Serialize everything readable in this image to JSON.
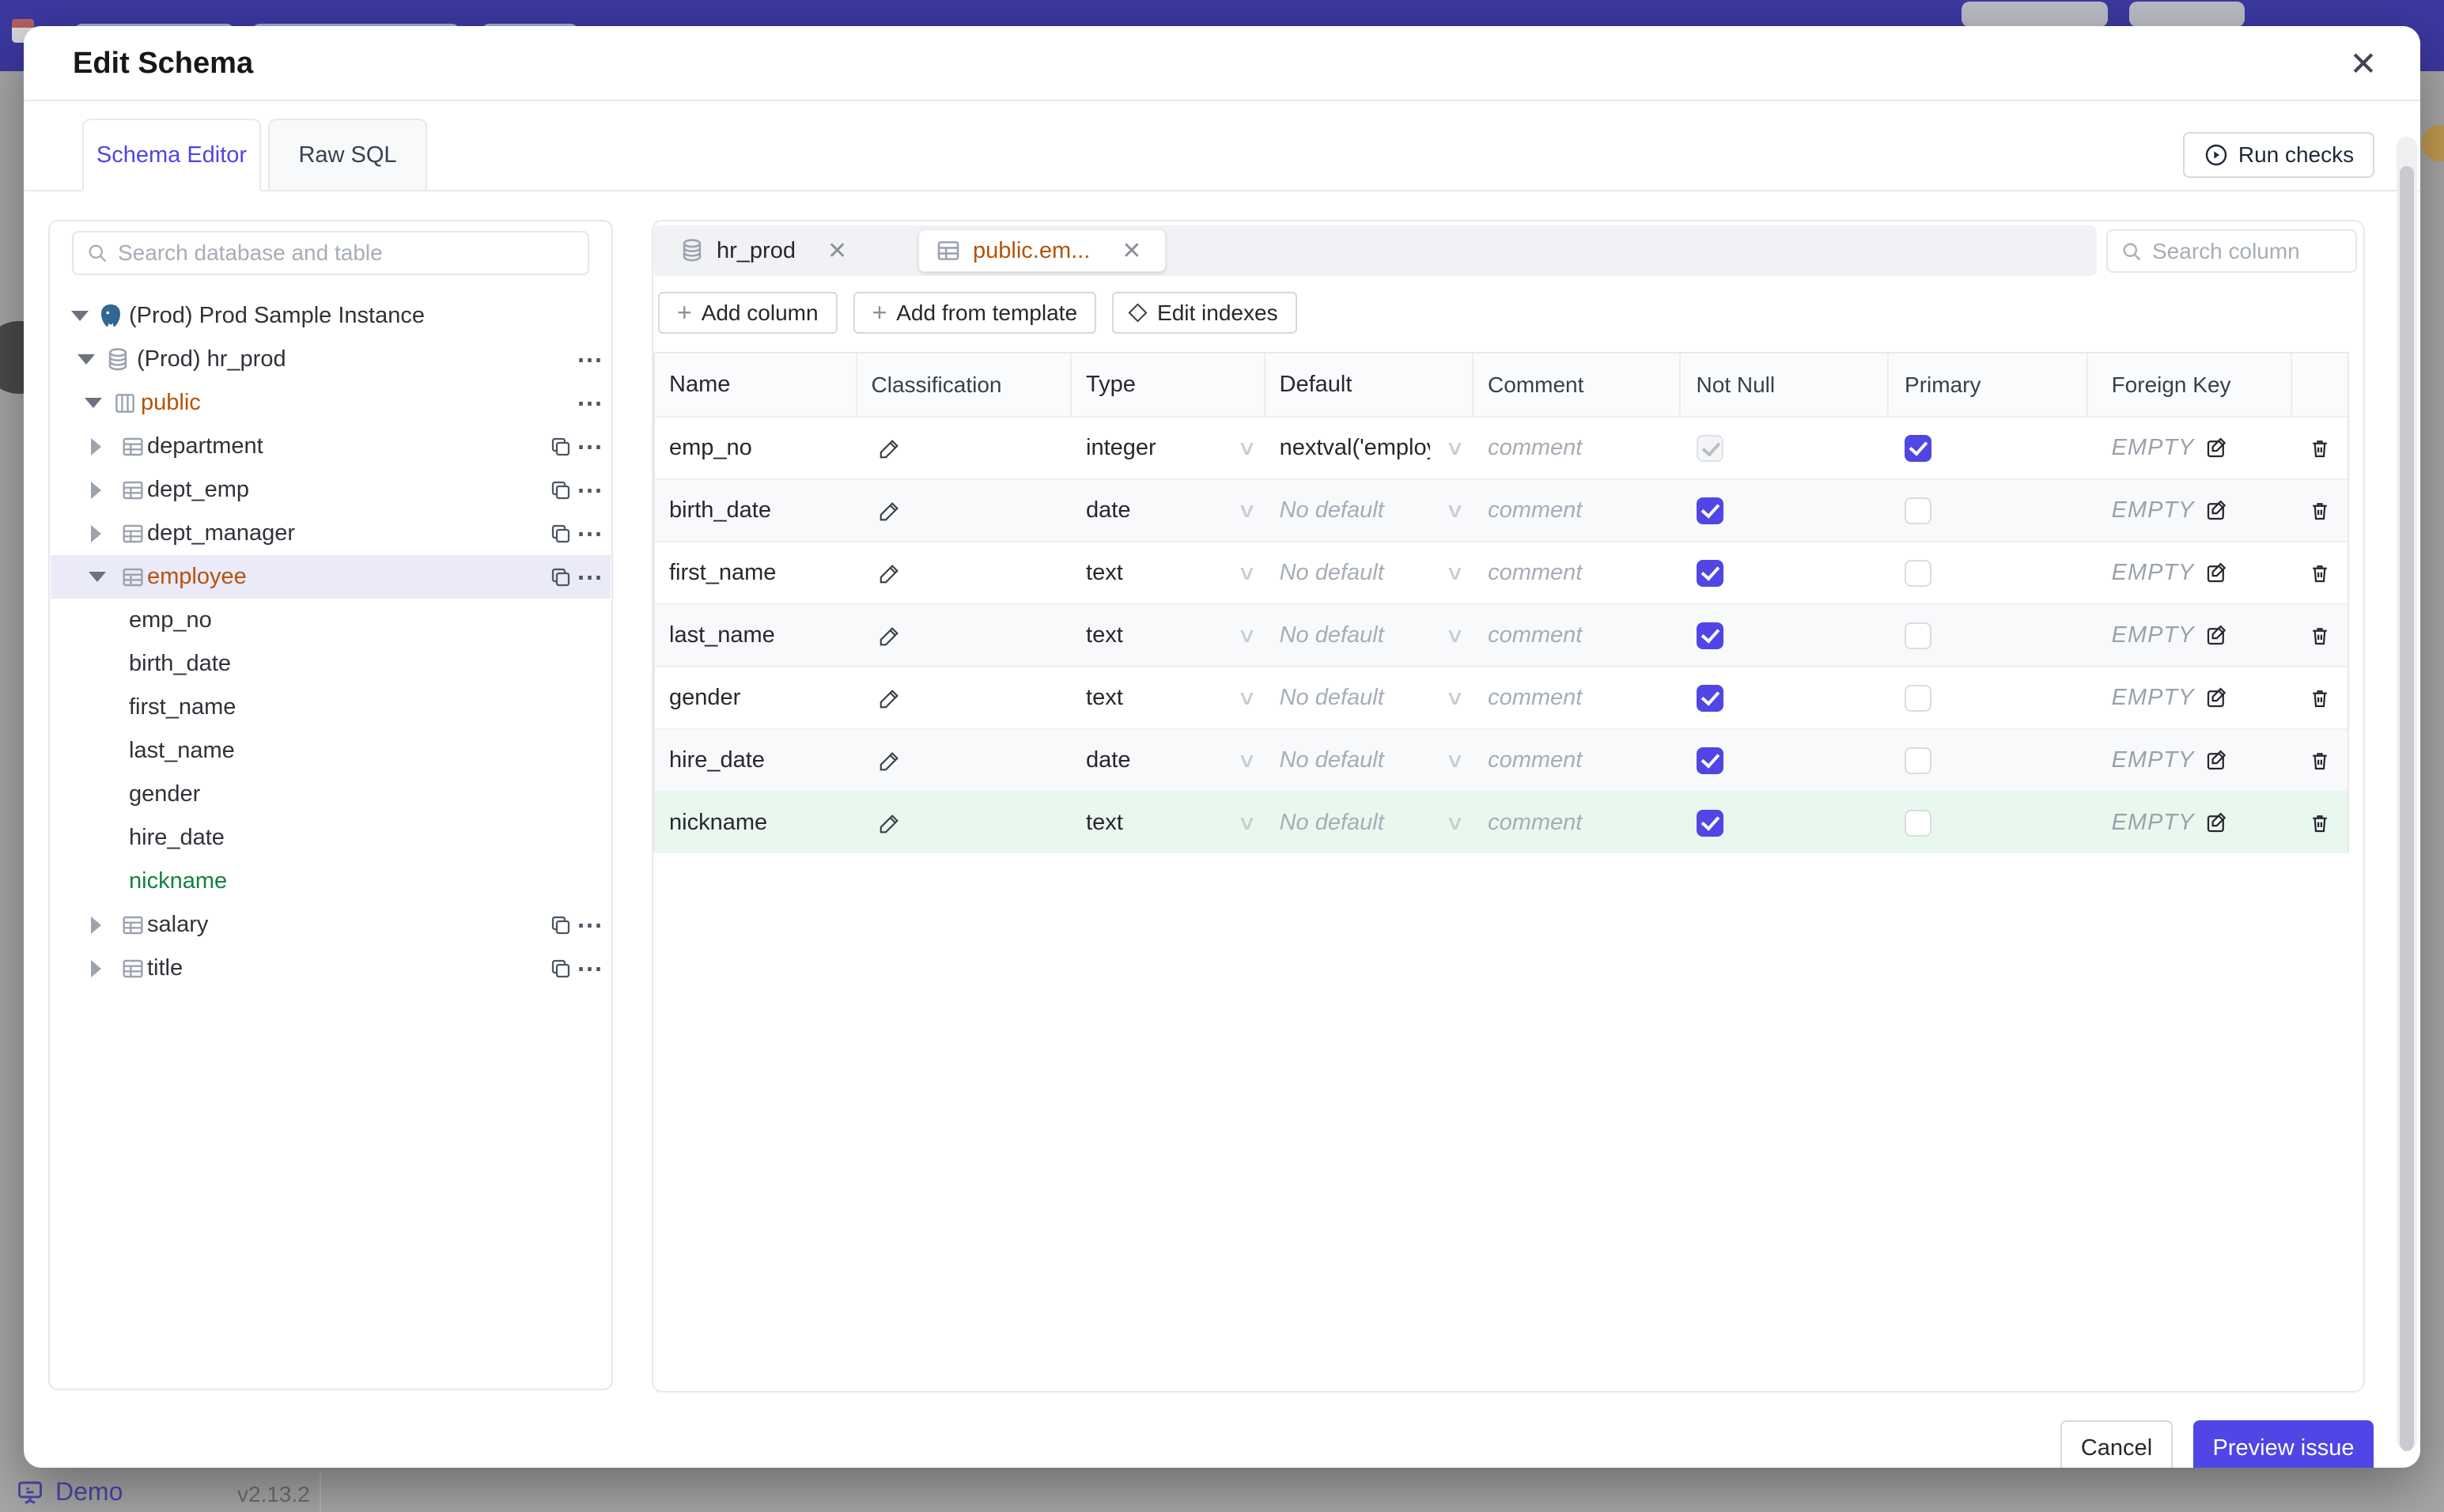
{
  "modal": {
    "title": "Edit Schema"
  },
  "icons": {
    "plus": "+",
    "close": "✕",
    "ellipsis": "⋯",
    "chevron_down": "∨"
  },
  "tabs": [
    {
      "label": "Schema Editor",
      "active": true
    },
    {
      "label": "Raw SQL",
      "active": false
    }
  ],
  "run_checks": {
    "label": "Run checks"
  },
  "sidebar": {
    "search_placeholder": "Search database and table",
    "tree": [
      {
        "level": 0,
        "icon": "postgres",
        "label": "(Prod) Prod Sample Instance",
        "expanded": true
      },
      {
        "level": 1,
        "icon": "database",
        "label": "(Prod) hr_prod",
        "expanded": true
      },
      {
        "level": 2,
        "icon": "schema",
        "label": "public",
        "expanded": true,
        "color": "orange"
      },
      {
        "level": 3,
        "icon": "table",
        "label": "department",
        "expanded": false
      },
      {
        "level": 3,
        "icon": "table",
        "label": "dept_emp",
        "expanded": false
      },
      {
        "level": 3,
        "icon": "table",
        "label": "dept_manager",
        "expanded": false
      },
      {
        "level": 3,
        "icon": "table",
        "label": "employee",
        "expanded": true,
        "color": "orange",
        "selected": true
      },
      {
        "level": 4,
        "icon": null,
        "label": "emp_no"
      },
      {
        "level": 4,
        "icon": null,
        "label": "birth_date"
      },
      {
        "level": 4,
        "icon": null,
        "label": "first_name"
      },
      {
        "level": 4,
        "icon": null,
        "label": "last_name"
      },
      {
        "level": 4,
        "icon": null,
        "label": "gender"
      },
      {
        "level": 4,
        "icon": null,
        "label": "hire_date"
      },
      {
        "level": 4,
        "icon": null,
        "label": "nickname",
        "color": "green"
      },
      {
        "level": 3,
        "icon": "table",
        "label": "salary",
        "expanded": false
      },
      {
        "level": 3,
        "icon": "table",
        "label": "title",
        "expanded": false
      }
    ]
  },
  "editor": {
    "open_tabs": [
      {
        "icon": "database",
        "label": "hr_prod",
        "active": false
      },
      {
        "icon": "table",
        "label": "public.em...",
        "active": true
      }
    ],
    "toolbar": {
      "add_column": "Add column",
      "add_from_template": "Add from template",
      "edit_indexes": "Edit indexes"
    },
    "search_placeholder": "Search column",
    "table": {
      "headers": [
        "Name",
        "Classification",
        "Type",
        "Default",
        "Comment",
        "Not Null",
        "Primary",
        "Foreign Key"
      ],
      "rows": [
        {
          "name": "emp_no",
          "type": "integer",
          "default": "nextval('employ",
          "default_is_placeholder": false,
          "comment_placeholder": "comment",
          "not_null": true,
          "not_null_disabled": true,
          "primary": true,
          "foreign_key": "EMPTY",
          "new": false
        },
        {
          "name": "birth_date",
          "type": "date",
          "default": "No default",
          "default_is_placeholder": true,
          "comment_placeholder": "comment",
          "not_null": true,
          "not_null_disabled": false,
          "primary": false,
          "foreign_key": "EMPTY",
          "new": false
        },
        {
          "name": "first_name",
          "type": "text",
          "default": "No default",
          "default_is_placeholder": true,
          "comment_placeholder": "comment",
          "not_null": true,
          "not_null_disabled": false,
          "primary": false,
          "foreign_key": "EMPTY",
          "new": false
        },
        {
          "name": "last_name",
          "type": "text",
          "default": "No default",
          "default_is_placeholder": true,
          "comment_placeholder": "comment",
          "not_null": true,
          "not_null_disabled": false,
          "primary": false,
          "foreign_key": "EMPTY",
          "new": false
        },
        {
          "name": "gender",
          "type": "text",
          "default": "No default",
          "default_is_placeholder": true,
          "comment_placeholder": "comment",
          "not_null": true,
          "not_null_disabled": false,
          "primary": false,
          "foreign_key": "EMPTY",
          "new": false
        },
        {
          "name": "hire_date",
          "type": "date",
          "default": "No default",
          "default_is_placeholder": true,
          "comment_placeholder": "comment",
          "not_null": true,
          "not_null_disabled": false,
          "primary": false,
          "foreign_key": "EMPTY",
          "new": false
        },
        {
          "name": "nickname",
          "type": "text",
          "default": "No default",
          "default_is_placeholder": true,
          "comment_placeholder": "comment",
          "not_null": true,
          "not_null_disabled": false,
          "primary": false,
          "foreign_key": "EMPTY",
          "new": true
        }
      ]
    }
  },
  "footer": {
    "cancel": "Cancel",
    "preview": "Preview issue"
  },
  "background": {
    "demo_label": "Demo",
    "version": "v2.13.2"
  },
  "colors": {
    "accent": "#4f46e5",
    "table_ref": "#b45309",
    "new_item": "#15803d",
    "new_row_bg": "#e9f8ef",
    "selected_row_bg": "#eaeaf8",
    "header_bar": "#3b38a0",
    "border": "#e5e7eb"
  }
}
